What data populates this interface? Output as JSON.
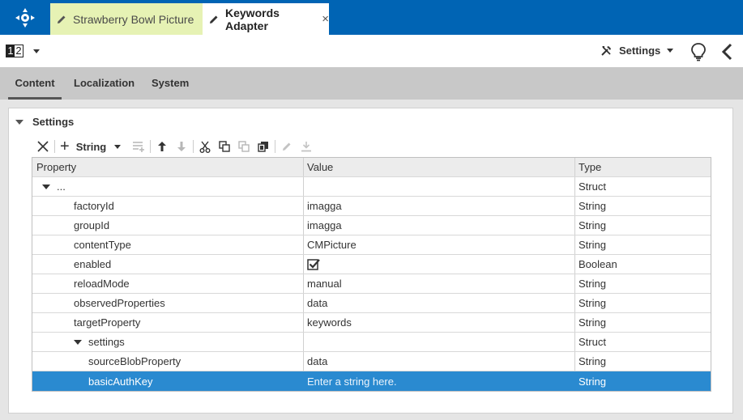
{
  "tabs": [
    {
      "label": "Strawberry Bowl Picture",
      "active": false
    },
    {
      "label": "Keywords Adapter",
      "active": true,
      "close": "×"
    }
  ],
  "toolbar": {
    "locale_icon": [
      "1",
      "2"
    ],
    "settings_label": "Settings"
  },
  "subtabs": [
    "Content",
    "Localization",
    "System"
  ],
  "panel": {
    "title": "Settings",
    "add_type_label": "String"
  },
  "table": {
    "headers": [
      "Property",
      "Value",
      "Type"
    ],
    "rows": [
      {
        "property": "...",
        "value": "",
        "type": "Struct",
        "depth": 0,
        "expandable": true
      },
      {
        "property": "factoryId",
        "value": "imagga",
        "type": "String",
        "depth": 1
      },
      {
        "property": "groupId",
        "value": "imagga",
        "type": "String",
        "depth": 1
      },
      {
        "property": "contentType",
        "value": "CMPicture",
        "type": "String",
        "depth": 1
      },
      {
        "property": "enabled",
        "value": "",
        "type": "Boolean",
        "depth": 1,
        "checked": true
      },
      {
        "property": "reloadMode",
        "value": "manual",
        "type": "String",
        "depth": 1
      },
      {
        "property": "observedProperties",
        "value": "data",
        "type": "String",
        "depth": 1
      },
      {
        "property": "targetProperty",
        "value": "keywords",
        "type": "String",
        "depth": 1
      },
      {
        "property": "settings",
        "value": "",
        "type": "Struct",
        "depth": 1,
        "expandable": true
      },
      {
        "property": "sourceBlobProperty",
        "value": "data",
        "type": "String",
        "depth": 2
      },
      {
        "property": "basicAuthKey",
        "value": "Enter a string here.",
        "type": "String",
        "depth": 2,
        "selected": true
      }
    ]
  },
  "colors": {
    "topbar": "#0064b4",
    "inactive_tab": "#e6f2b4",
    "selection": "#2a8ad0"
  }
}
